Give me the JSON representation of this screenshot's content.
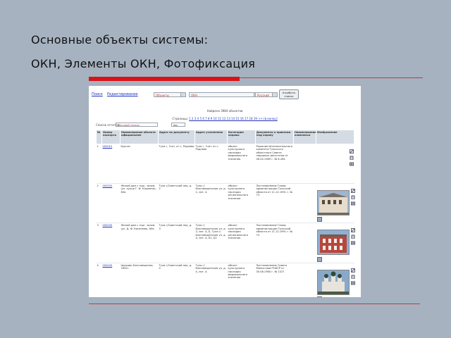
{
  "slide": {
    "title_line1": "Основные объекты системы:",
    "title_line2": "ОКН, Элементы ОКН, Фотофиксация"
  },
  "colors": {
    "background": "#a6b2c0",
    "accent_bar": "#d8121b",
    "link": "#2233bb"
  },
  "app": {
    "toolbar": {
      "search_link": "Поиск",
      "edit_link": "Редактирование",
      "object_select": "Объекты",
      "okn_select": "ОКН",
      "language_select": "Русский",
      "attributes_button_line1": "Атрибуты",
      "attributes_button_line2": "списка"
    },
    "found_text": "Найдено 3984 объектов",
    "pagination": {
      "label": "Страницы:",
      "pages": "1 2 3 4 5 6 7 8 9 10 11 12 13 14 15 16 17 18 19 >> [в конец]"
    },
    "sort": {
      "label": "Список отчетов:",
      "value": "Текущий список",
      "order": "Asc"
    },
    "columns": [
      "№",
      "Номер паспорта",
      "Наименование объекта официальное",
      "Адрес по документу",
      "Адрес уточненное",
      "Категория охраны",
      "Документы о принятии под охрану",
      "Наименование комплекса",
      "Изображение"
    ],
    "rows": [
      {
        "n": "1",
        "passport": "000010",
        "name": "Курган",
        "addr_doc": "Тула г, 3-ен. от с. Роднево",
        "addr_exact": "Тула г, 3-ен. от с. Роднево",
        "category": "объект культурного наследия федерального значения",
        "documents": "Решение Исполнительного комитета Тульского областного Совета народных депутатов от 06.04.1989 г. № 6-264",
        "complex": "",
        "has_photo": false
      },
      {
        "n": "2",
        "passport": "000020",
        "name": "Жилой дом с торг. залом (ул. купца Г. Ф. Юрьевна), 60е.",
        "addr_doc": "Тула г/Советский пер, д. 2",
        "addr_exact": "Тула г/Благовещенская ул, д. 2, лит. А",
        "category": "объект культурного наследия регионального значения",
        "documents": "Постановление Главы администрации Тульской области от 11.12.1991 г. № 73",
        "complex": "",
        "has_photo": true
      },
      {
        "n": "3",
        "passport": "000030",
        "name": "Жилой дом с торг. залом (ул. Д. Ф. Киселева), 60е.",
        "addr_doc": "Тула г/Советский пер, д. 3",
        "addr_exact": "Тула г/Благовещенская ул, д. 3, лит. А, Б, Тула г/Благовещенская ул, д. 4, лит. А, Б1, Б2",
        "category": "объект культурного наследия регионального значения",
        "documents": "Постановление Главы администрации Тульской области от 11.12.1991 г. № 73",
        "complex": "",
        "has_photo": true
      },
      {
        "n": "4",
        "passport": "000040",
        "name": "Церковь Благовещения, 1692г.",
        "addr_doc": "Тула г/Советский пер, д. 4",
        "addr_exact": "Тула г/Благовещенская ул, д. 4, лит. А",
        "category": "объект культурного наследия федерального значения",
        "documents": "Постановление Совета Министров РСФСР от 30.08.1960 г. № 1327",
        "complex": "",
        "has_photo": true
      }
    ]
  }
}
